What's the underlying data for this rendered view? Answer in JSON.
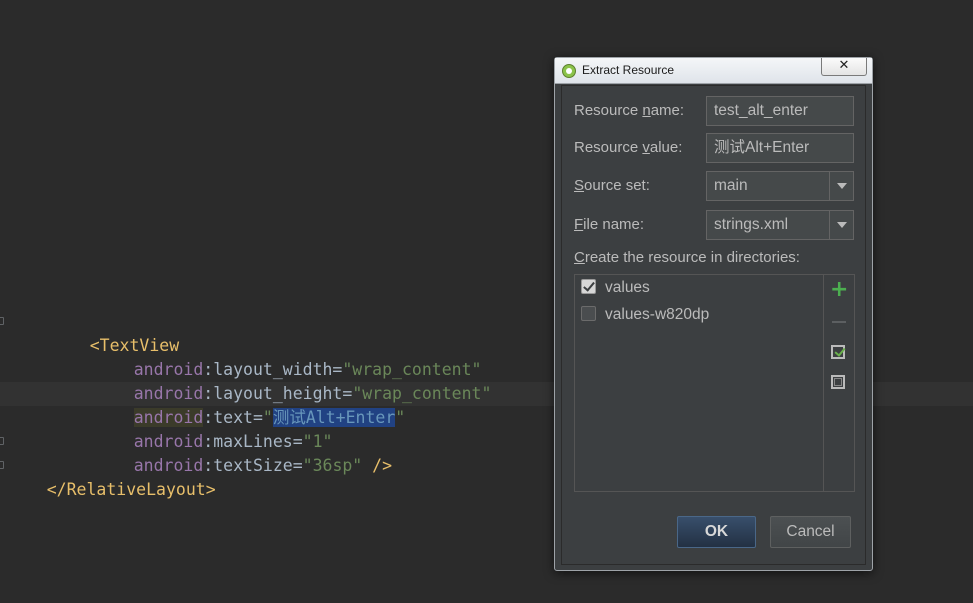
{
  "editor": {
    "lines": [
      {
        "open_tag": "<TextView"
      },
      {
        "ns": "android",
        "attr": ":layout_width=",
        "value": "\"wrap_content\""
      },
      {
        "ns": "android",
        "attr": ":layout_height=",
        "value": "\"wrap_content\""
      },
      {
        "ns": "android",
        "attr": ":text=",
        "quote_open": "\"",
        "selected": "测试Alt+Enter",
        "quote_close": "\""
      },
      {
        "ns": "android",
        "attr": ":maxLines=",
        "value": "\"1\""
      },
      {
        "ns": "android",
        "attr": ":textSize=",
        "value": "\"36sp\"",
        "tail": " />"
      },
      {
        "close_tag": "</RelativeLayout>"
      }
    ]
  },
  "dialog": {
    "title": "Extract Resource",
    "close_glyph": "✕",
    "resource_name": {
      "label_pre": "Resource ",
      "label_u": "n",
      "label_post": "ame:",
      "value": "test_alt_enter"
    },
    "resource_value": {
      "label_pre": "Resource ",
      "label_u": "v",
      "label_post": "alue:",
      "value": "测试Alt+Enter"
    },
    "source_set": {
      "label_u": "S",
      "label_post": "ource set:",
      "value": "main"
    },
    "file_name": {
      "label_u": "F",
      "label_post": "ile name:",
      "value": "strings.xml"
    },
    "directories": {
      "label_u": "C",
      "label_post": "reate the resource in directories:",
      "items": [
        {
          "name": "values",
          "checked": true
        },
        {
          "name": "values-w820dp",
          "checked": false
        }
      ],
      "plus_glyph": "+"
    },
    "ok_label": "OK",
    "cancel_label": "Cancel"
  },
  "colors": {
    "editor_bg": "#2b2b2b",
    "tag": "#e8bf6a",
    "namespace": "#9876aa",
    "string_value": "#6a8759",
    "selection": "#214283",
    "dialog_bg": "#3c3f41"
  }
}
